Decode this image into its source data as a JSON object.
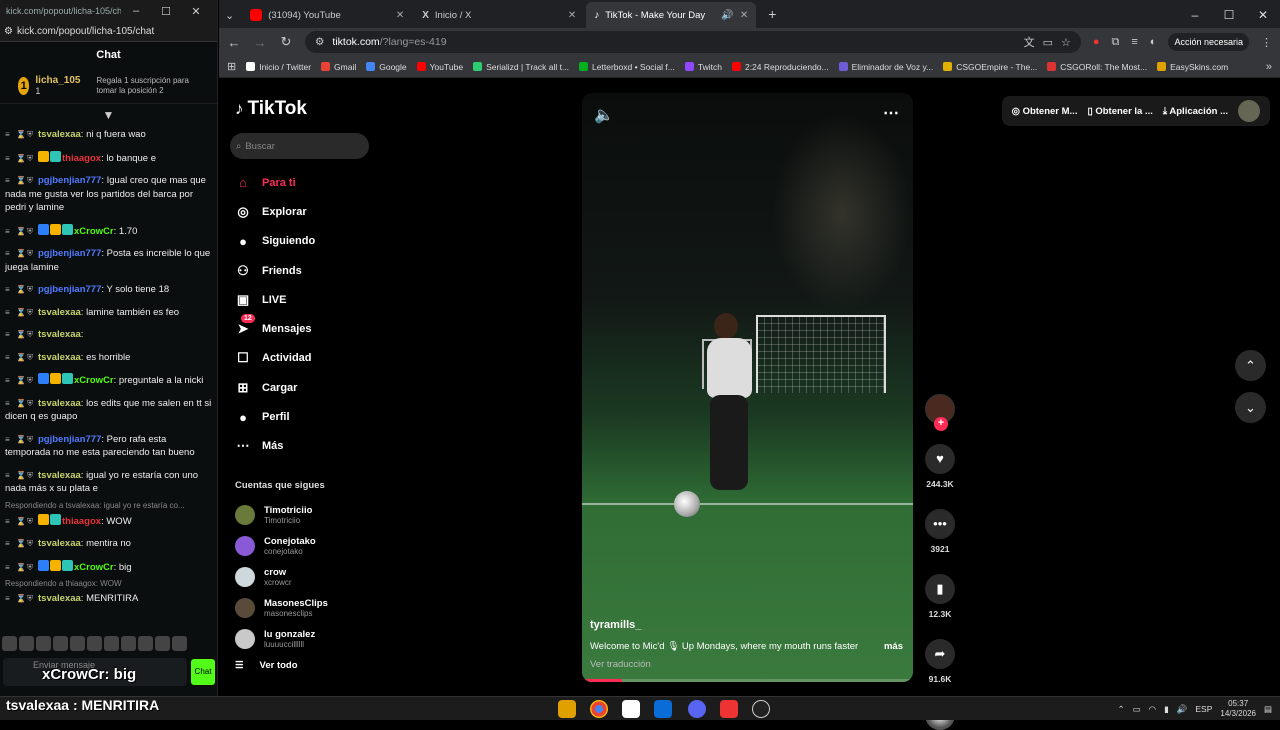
{
  "popup": {
    "title": "kick.com/popout/licha-105/cha...",
    "url": "kick.com/popout/licha-105/chat",
    "chat_header": "Chat",
    "leader": {
      "rank": "1",
      "name": "licha_105",
      "count": "1",
      "gift_text": "Regala 1 suscripción para tomar la posición 2"
    },
    "messages": [
      {
        "user": "tsvalexaa",
        "color": "#c8d46a",
        "text": ": ni q fuera wao",
        "badge_colors": []
      },
      {
        "user": "thiaagox",
        "color": "#e9333b",
        "text": ": lo banque e",
        "badge_colors": [
          "#f5b300",
          "#2ec4b6"
        ]
      },
      {
        "user": "pgjbenjian777",
        "color": "#4f7bff",
        "text": ": Igual creo que mas que nada me gusta ver los partidos del barca por pedri y lamine",
        "badge_colors": []
      },
      {
        "user": "xCrowCr",
        "color": "#53fc18",
        "text": ": 1.70",
        "badge_colors": [
          "#2d7ff9",
          "#f5b300",
          "#2ec4b6"
        ]
      },
      {
        "user": "pgjbenjian777",
        "color": "#4f7bff",
        "text": ": Posta es increible lo que juega lamine",
        "badge_colors": []
      },
      {
        "user": "pgjbenjian777",
        "color": "#4f7bff",
        "text": ": Y solo tiene 18",
        "badge_colors": []
      },
      {
        "user": "tsvalexaa",
        "color": "#c8d46a",
        "text": ": lamine también es feo",
        "badge_colors": []
      },
      {
        "user": "tsvalexaa",
        "color": "#c8d46a",
        "text": ":",
        "badge_colors": []
      },
      {
        "user": "tsvalexaa",
        "color": "#c8d46a",
        "text": ": es horrible",
        "badge_colors": []
      },
      {
        "user": "xCrowCr",
        "color": "#53fc18",
        "text": ": preguntale a la nicki",
        "badge_colors": [
          "#2d7ff9",
          "#f5b300",
          "#2ec4b6"
        ]
      },
      {
        "user": "tsvalexaa",
        "color": "#c8d46a",
        "text": ": los edits que me salen en tt si dicen q es guapo",
        "badge_colors": []
      },
      {
        "user": "pgjbenjian777",
        "color": "#4f7bff",
        "text": ": Pero rafa esta temporada no me esta pareciendo tan bueno",
        "badge_colors": []
      },
      {
        "user": "tsvalexaa",
        "color": "#c8d46a",
        "text": ": igual yo re estaría con uno nada más x su plata e",
        "badge_colors": []
      },
      {
        "reply": "Respondiendo a tsvalexaa: igual yo re estaría co...",
        "user": "thiaagox",
        "color": "#e9333b",
        "text": ": WOW",
        "badge_colors": [
          "#f5b300",
          "#2ec4b6"
        ]
      },
      {
        "user": "tsvalexaa",
        "color": "#c8d46a",
        "text": ": mentira no",
        "badge_colors": []
      },
      {
        "user": "xCrowCr",
        "color": "#53fc18",
        "text": ": big",
        "badge_colors": [
          "#2d7ff9",
          "#f5b300",
          "#2ec4b6"
        ]
      },
      {
        "reply": "Respondiendo a thiaagox: WOW",
        "user": "tsvalexaa",
        "color": "#c8d46a",
        "text": ": MENRITIRA",
        "badge_colors": []
      }
    ],
    "input_placeholder": "Enviar mensaje",
    "send_label": "Chat",
    "overlay_text": "xCrowCr: big"
  },
  "browser": {
    "tabs": [
      {
        "title": "(31094) YouTube",
        "color": "#ff0000"
      },
      {
        "title": "Inicio / X",
        "color": "#ffffff"
      },
      {
        "title": "TikTok - Make Your Day",
        "color": "#ffffff"
      }
    ],
    "url_host": "tiktok.com",
    "url_path": "/?lang=es-419",
    "action_label": "Acción necesaria",
    "bookmarks": [
      {
        "label": "Inicio / Twitter",
        "color": "#fff"
      },
      {
        "label": "Gmail",
        "color": "#ea4335"
      },
      {
        "label": "Google",
        "color": "#4285f4"
      },
      {
        "label": "YouTube",
        "color": "#ff0000"
      },
      {
        "label": "Serializd | Track all t...",
        "color": "#2ecc71"
      },
      {
        "label": "Letterboxd • Social f...",
        "color": "#00b020"
      },
      {
        "label": "Twitch",
        "color": "#9146ff"
      },
      {
        "label": "2:24 Reproduciendo...",
        "color": "#ff0000"
      },
      {
        "label": "Eliminador de Voz y...",
        "color": "#6f5bd6"
      },
      {
        "label": "CSGOEmpire - The...",
        "color": "#e0b000"
      },
      {
        "label": "CSGORoll: The Most...",
        "color": "#d33"
      },
      {
        "label": "EasySkins.com",
        "color": "#e0a000"
      }
    ]
  },
  "tiktok": {
    "logo": "TikTok",
    "search_placeholder": "Buscar",
    "nav": [
      {
        "label": "Para ti",
        "icon": "home-icon",
        "glyph": "⌂"
      },
      {
        "label": "Explorar",
        "icon": "compass-icon",
        "glyph": "◎"
      },
      {
        "label": "Siguiendo",
        "icon": "following-avatar-icon",
        "glyph": "●"
      },
      {
        "label": "Friends",
        "icon": "friends-icon",
        "glyph": "⚇"
      },
      {
        "label": "LIVE",
        "icon": "live-icon",
        "glyph": "▣"
      },
      {
        "label": "Mensajes",
        "icon": "messages-icon",
        "glyph": "➤",
        "badge": "12"
      },
      {
        "label": "Actividad",
        "icon": "activity-icon",
        "glyph": "☐"
      },
      {
        "label": "Cargar",
        "icon": "upload-icon",
        "glyph": "⊞"
      },
      {
        "label": "Perfil",
        "icon": "profile-icon",
        "glyph": "●"
      },
      {
        "label": "Más",
        "icon": "more-icon",
        "glyph": "⋯"
      }
    ],
    "following_title": "Cuentas que sigues",
    "following": [
      {
        "name": "Timotriciio",
        "handle": "Timotriciio",
        "color": "#6a7a3a"
      },
      {
        "name": "Conejotako",
        "handle": "conejotako",
        "color": "#8a5ad6"
      },
      {
        "name": "crow",
        "handle": "xcrowcr",
        "color": "#cfd8dc"
      },
      {
        "name": "MasonesClips",
        "handle": "masonesclips",
        "color": "#5a4a3a"
      },
      {
        "name": "lu gonzalez",
        "handle": "luuuuccillllll",
        "color": "#c9c9c9"
      }
    ],
    "see_all": "Ver todo",
    "video": {
      "author": "tyramills_",
      "caption": "Welcome to Mic'd 🎙 Up Mondays, where my mouth runs faster",
      "more": "más",
      "translate": "Ver traducción",
      "progress": 0.12,
      "likes": "244.3K",
      "comments": "3921",
      "saves": "12.3K",
      "shares": "91.6K"
    },
    "topbar": [
      "Obtener M...",
      "Obtener la ...",
      "Aplicación ..."
    ]
  },
  "taskbar": {
    "lang": "ESP",
    "time": "05:37",
    "date": "14/3/2026"
  },
  "stream_overlay": "tsvalexaa : MENRITIRA"
}
